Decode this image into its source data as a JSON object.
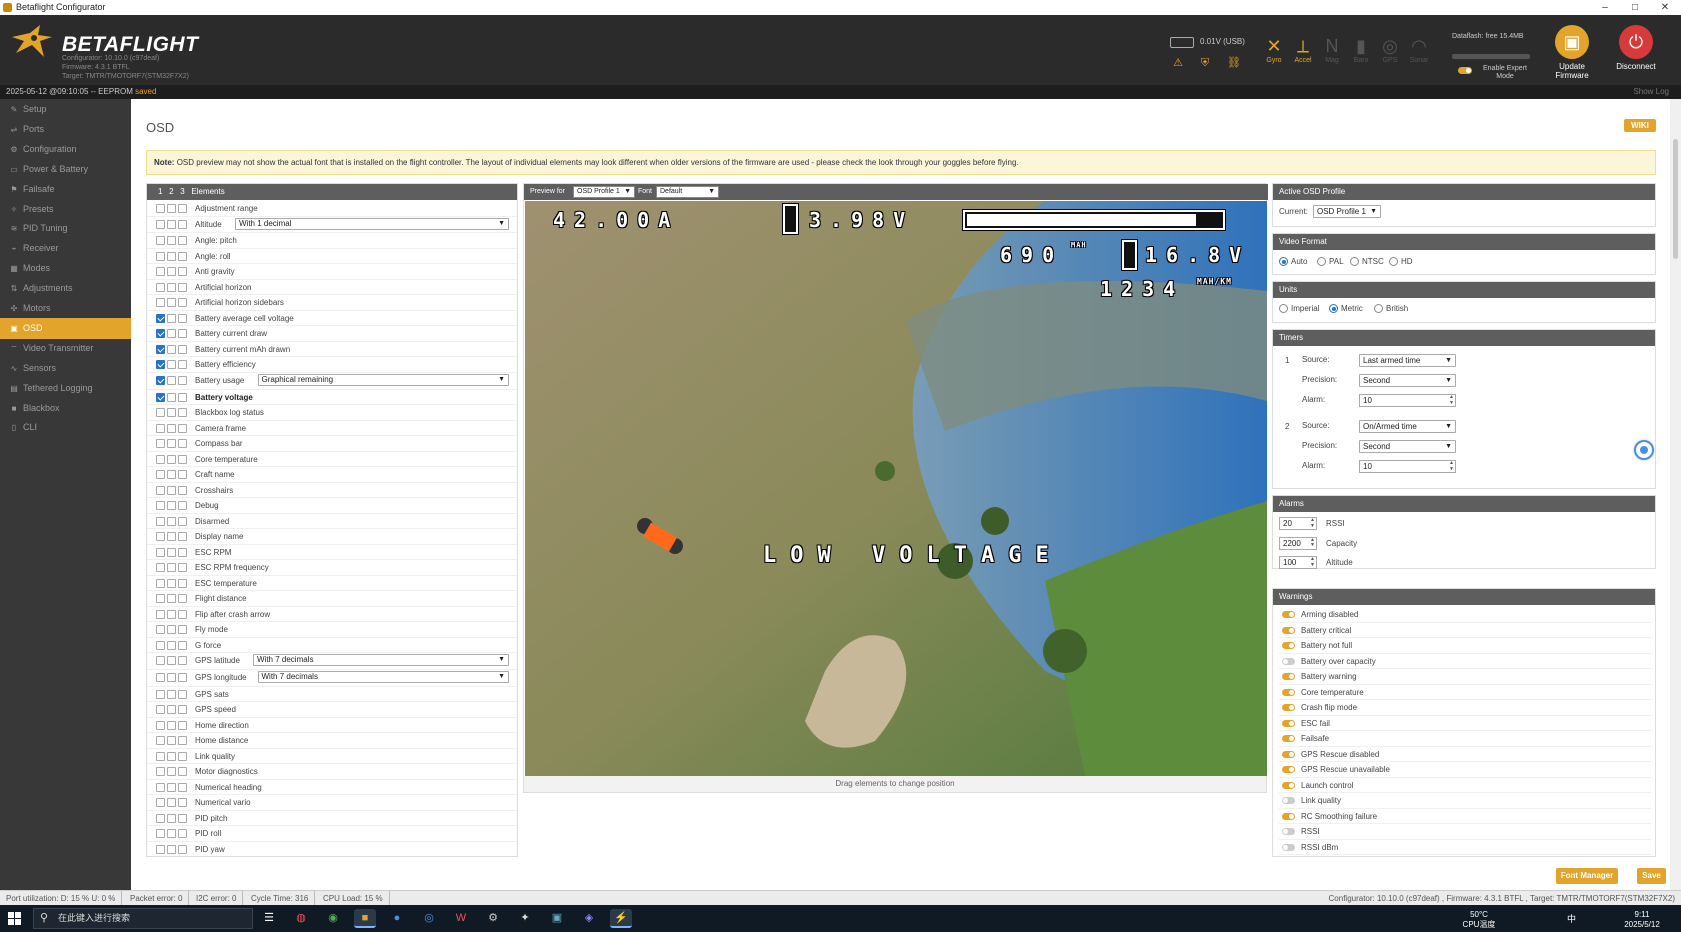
{
  "window": {
    "title": "Betaflight Configurator",
    "controls": [
      "–",
      "□",
      "✕"
    ]
  },
  "header": {
    "logo": "BETAFLIGHT",
    "info_lines": [
      "Configurator: 10.10.0 (c97deaf)",
      "Firmware: 4.3.1 BTFL",
      "Target: TMTR/TMOTORF7(STM32F7X2)"
    ],
    "battery": "0.01V (USB)",
    "sensors": [
      {
        "label": "Gyro",
        "icon": "gyro-icon",
        "active": true
      },
      {
        "label": "Accel",
        "icon": "accel-icon",
        "active": true
      },
      {
        "label": "Mag",
        "icon": "mag-icon",
        "active": false
      },
      {
        "label": "Baro",
        "icon": "baro-icon",
        "active": false
      },
      {
        "label": "GPS",
        "icon": "gps-icon",
        "active": false
      },
      {
        "label": "Sonar",
        "icon": "sonar-icon",
        "active": false
      }
    ],
    "dataflash": "Dataflash: free 15.4MB",
    "expert_mode": "Enable Expert Mode",
    "update_firmware": "Update Firmware",
    "disconnect": "Disconnect"
  },
  "log": {
    "timestamp": "2025-05-12 @09:10:05 -- EEPROM",
    "status": "saved",
    "show_log": "Show Log"
  },
  "sidebar": {
    "items": [
      {
        "label": "Setup",
        "icon": "wrench-icon",
        "active": false
      },
      {
        "label": "Ports",
        "icon": "plug-icon",
        "active": false
      },
      {
        "label": "Configuration",
        "icon": "gear-icon",
        "active": false
      },
      {
        "label": "Power & Battery",
        "icon": "battery-icon",
        "active": false
      },
      {
        "label": "Failsafe",
        "icon": "failsafe-icon",
        "active": false
      },
      {
        "label": "Presets",
        "icon": "presets-icon",
        "active": false
      },
      {
        "label": "PID Tuning",
        "icon": "pid-icon",
        "active": false
      },
      {
        "label": "Receiver",
        "icon": "receiver-icon",
        "active": false
      },
      {
        "label": "Modes",
        "icon": "modes-icon",
        "active": false
      },
      {
        "label": "Adjustments",
        "icon": "adjust-icon",
        "active": false
      },
      {
        "label": "Motors",
        "icon": "motor-icon",
        "active": false
      },
      {
        "label": "OSD",
        "icon": "osd-icon",
        "active": true
      },
      {
        "label": "Video Transmitter",
        "icon": "vtx-icon",
        "active": false
      },
      {
        "label": "Sensors",
        "icon": "sensor-icon",
        "active": false
      },
      {
        "label": "Tethered Logging",
        "icon": "log-icon",
        "active": false
      },
      {
        "label": "Blackbox",
        "icon": "blackbox-icon",
        "active": false
      },
      {
        "label": "CLI",
        "icon": "cli-icon",
        "active": false
      }
    ]
  },
  "page": {
    "title": "OSD",
    "wiki": "WIKI",
    "note_bold": "Note:",
    "note": "OSD preview may not show the actual font that is installed on the flight controller. The layout of individual elements may look different when older versions of the firmware are used - please check the look through your goggles before flying."
  },
  "elements": {
    "header": {
      "profiles": [
        "1",
        "2",
        "3"
      ],
      "label": "Elements"
    },
    "rows": [
      {
        "label": "Adjustment range",
        "checks": [
          false,
          false,
          false
        ]
      },
      {
        "label": "Altitude",
        "checks": [
          false,
          false,
          false
        ],
        "select": "With 1 decimal"
      },
      {
        "label": "Angle: pitch",
        "checks": [
          false,
          false,
          false
        ]
      },
      {
        "label": "Angle: roll",
        "checks": [
          false,
          false,
          false
        ]
      },
      {
        "label": "Anti gravity",
        "checks": [
          false,
          false,
          false
        ]
      },
      {
        "label": "Artificial horizon",
        "checks": [
          false,
          false,
          false
        ]
      },
      {
        "label": "Artificial horizon sidebars",
        "checks": [
          false,
          false,
          false
        ]
      },
      {
        "label": "Battery average cell voltage",
        "checks": [
          true,
          false,
          false
        ]
      },
      {
        "label": "Battery current draw",
        "checks": [
          true,
          false,
          false
        ]
      },
      {
        "label": "Battery current mAh drawn",
        "checks": [
          true,
          false,
          false
        ]
      },
      {
        "label": "Battery efficiency",
        "checks": [
          true,
          false,
          false
        ]
      },
      {
        "label": "Battery usage",
        "checks": [
          true,
          false,
          false
        ],
        "select": "Graphical remaining"
      },
      {
        "label": "Battery voltage",
        "checks": [
          true,
          false,
          false
        ],
        "bold": true
      },
      {
        "label": "Blackbox log status",
        "checks": [
          false,
          false,
          false
        ]
      },
      {
        "label": "Camera frame",
        "checks": [
          false,
          false,
          false
        ]
      },
      {
        "label": "Compass bar",
        "checks": [
          false,
          false,
          false
        ]
      },
      {
        "label": "Core temperature",
        "checks": [
          false,
          false,
          false
        ]
      },
      {
        "label": "Craft name",
        "checks": [
          false,
          false,
          false
        ]
      },
      {
        "label": "Crosshairs",
        "checks": [
          false,
          false,
          false
        ]
      },
      {
        "label": "Debug",
        "checks": [
          false,
          false,
          false
        ]
      },
      {
        "label": "Disarmed",
        "checks": [
          false,
          false,
          false
        ]
      },
      {
        "label": "Display name",
        "checks": [
          false,
          false,
          false
        ]
      },
      {
        "label": "ESC RPM",
        "checks": [
          false,
          false,
          false
        ]
      },
      {
        "label": "ESC RPM frequency",
        "checks": [
          false,
          false,
          false
        ]
      },
      {
        "label": "ESC temperature",
        "checks": [
          false,
          false,
          false
        ]
      },
      {
        "label": "Flight distance",
        "checks": [
          false,
          false,
          false
        ]
      },
      {
        "label": "Flip after crash arrow",
        "checks": [
          false,
          false,
          false
        ]
      },
      {
        "label": "Fly mode",
        "checks": [
          false,
          false,
          false
        ]
      },
      {
        "label": "G force",
        "checks": [
          false,
          false,
          false
        ]
      },
      {
        "label": "GPS latitude",
        "checks": [
          false,
          false,
          false
        ],
        "select": "With 7 decimals"
      },
      {
        "label": "GPS longitude",
        "checks": [
          false,
          false,
          false
        ],
        "select": "With 7 decimals"
      },
      {
        "label": "GPS sats",
        "checks": [
          false,
          false,
          false
        ]
      },
      {
        "label": "GPS speed",
        "checks": [
          false,
          false,
          false
        ]
      },
      {
        "label": "Home direction",
        "checks": [
          false,
          false,
          false
        ]
      },
      {
        "label": "Home distance",
        "checks": [
          false,
          false,
          false
        ]
      },
      {
        "label": "Link quality",
        "checks": [
          false,
          false,
          false
        ]
      },
      {
        "label": "Motor diagnostics",
        "checks": [
          false,
          false,
          false
        ]
      },
      {
        "label": "Numerical heading",
        "checks": [
          false,
          false,
          false
        ]
      },
      {
        "label": "Numerical vario",
        "checks": [
          false,
          false,
          false
        ]
      },
      {
        "label": "PID pitch",
        "checks": [
          false,
          false,
          false
        ]
      },
      {
        "label": "PID roll",
        "checks": [
          false,
          false,
          false
        ]
      },
      {
        "label": "PID yaw",
        "checks": [
          false,
          false,
          false
        ]
      }
    ]
  },
  "preview": {
    "label_preview": "Preview for",
    "profile": "OSD Profile 1",
    "label_font": "Font",
    "font": "Default",
    "osd": {
      "current": "42.00A",
      "voltage": "3.98V",
      "mah": "690",
      "mah_unit": "MAH",
      "batt_voltage": "16.8V",
      "efficiency": "1234",
      "efficiency_unit": "MAH/KM",
      "warning": "LOW VOLTAGE",
      "battery_level": 0.9
    },
    "footer": "Drag elements to change position"
  },
  "right": {
    "active_profile": {
      "title": "Active OSD Profile",
      "label": "Current:",
      "value": "OSD Profile 1"
    },
    "video_format": {
      "title": "Video Format",
      "options": [
        "Auto",
        "PAL",
        "NTSC",
        "HD"
      ],
      "selected": 0
    },
    "units": {
      "title": "Units",
      "options": [
        "Imperial",
        "Metric",
        "British"
      ],
      "selected": 1
    },
    "timers": {
      "title": "Timers",
      "items": [
        {
          "num": "1",
          "source_label": "Source:",
          "source": "Last armed time",
          "precision_label": "Precision:",
          "precision": "Second",
          "alarm_label": "Alarm:",
          "alarm": "10"
        },
        {
          "num": "2",
          "source_label": "Source:",
          "source": "On/Armed time",
          "precision_label": "Precision:",
          "precision": "Second",
          "alarm_label": "Alarm:",
          "alarm": "10"
        }
      ]
    },
    "alarms": {
      "title": "Alarms",
      "items": [
        {
          "value": "20",
          "label": "RSSI"
        },
        {
          "value": "2200",
          "label": "Capacity"
        },
        {
          "value": "100",
          "label": "Altitude"
        }
      ]
    },
    "warnings": {
      "title": "Warnings",
      "items": [
        {
          "label": "Arming disabled",
          "on": true
        },
        {
          "label": "Battery critical",
          "on": true
        },
        {
          "label": "Battery not full",
          "on": true
        },
        {
          "label": "Battery over capacity",
          "on": false
        },
        {
          "label": "Battery warning",
          "on": true
        },
        {
          "label": "Core temperature",
          "on": true
        },
        {
          "label": "Crash flip mode",
          "on": true
        },
        {
          "label": "ESC fail",
          "on": true
        },
        {
          "label": "Failsafe",
          "on": true
        },
        {
          "label": "GPS Rescue disabled",
          "on": true
        },
        {
          "label": "GPS Rescue unavailable",
          "on": true
        },
        {
          "label": "Launch control",
          "on": true
        },
        {
          "label": "Link quality",
          "on": false
        },
        {
          "label": "RC Smoothing failure",
          "on": true
        },
        {
          "label": "RSSI",
          "on": false
        },
        {
          "label": "RSSI dBm",
          "on": false
        }
      ]
    }
  },
  "buttons": {
    "font_manager": "Font Manager",
    "save": "Save"
  },
  "statusbar": {
    "port_util": "Port utilization: D: 15 % U: 0 %",
    "packet_error": "Packet error: 0",
    "i2c_error": "I2C error: 0",
    "cycle_time": "Cycle Time: 316",
    "cpu_load": "CPU Load: 15 %",
    "right": "Configurator: 10.10.0 (c97deaf) , Firmware: 4.3.1 BTFL , Target: TMTR/TMOTORF7(STM32F7X2)"
  },
  "taskbar": {
    "search_placeholder": "在此键入进行搜索",
    "temp": "50°C",
    "cpu_temp": "CPU温度",
    "time": "9:11",
    "date": "2025/5/12",
    "ime": "中"
  },
  "colors": {
    "accent": "#e2a42b",
    "checked": "#2a72c8"
  }
}
